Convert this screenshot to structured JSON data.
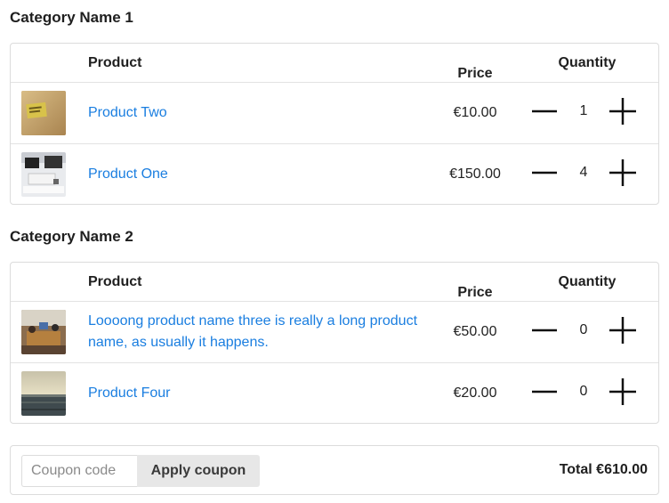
{
  "categories": [
    {
      "title": "Category Name 1",
      "headers": {
        "product": "Product",
        "price": "Price",
        "quantity": "Quantity"
      },
      "items": [
        {
          "name": "Product Two",
          "price": "€10.00",
          "quantity": "1",
          "thumbnail": "product-two-thumbnail"
        },
        {
          "name": "Product One",
          "price": "€150.00",
          "quantity": "4",
          "thumbnail": "product-one-thumbnail"
        }
      ]
    },
    {
      "title": "Category Name 2",
      "headers": {
        "product": "Product",
        "price": "Price",
        "quantity": "Quantity"
      },
      "items": [
        {
          "name": "Loooong product name three is really a long product name, as usually it happens.",
          "price": "€50.00",
          "quantity": "0",
          "thumbnail": "product-three-thumbnail"
        },
        {
          "name": "Product Four",
          "price": "€20.00",
          "quantity": "0",
          "thumbnail": "product-four-thumbnail"
        }
      ]
    }
  ],
  "footer": {
    "coupon_placeholder": "Coupon code",
    "coupon_value": "",
    "apply_label": "Apply coupon",
    "total_text": "Total €610.00"
  },
  "icons": {
    "decrease": "minus-icon",
    "increase": "plus-icon"
  },
  "colors": {
    "link": "#1a7ee0",
    "border": "#dcdcdc",
    "button_bg": "#e7e7e7"
  }
}
